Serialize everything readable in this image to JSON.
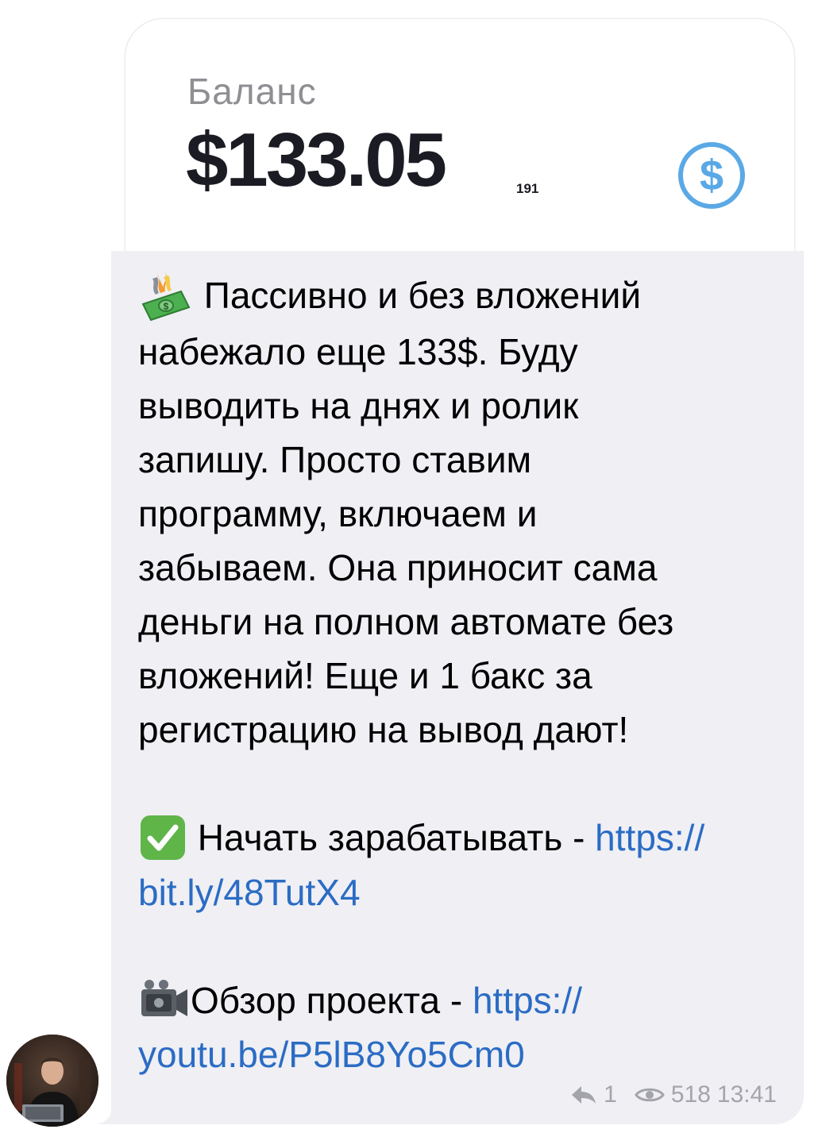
{
  "balance": {
    "label": "Баланс",
    "amount": "$133.05",
    "decimals": "191",
    "icon": "dollar-circle-icon",
    "accent_color": "#5aa9e6"
  },
  "message": {
    "paragraph1": [
      "Пассивно и без вложений",
      "набежало еще 133$. Буду",
      "выводить на днях и ролик",
      "запишу. Просто ставим",
      "программу, включаем и",
      "забываем. Она приносит сама",
      "деньги на полном автомате без",
      "вложений! Еще и 1 бакс за",
      "регистрацию на вывод дают!"
    ],
    "cta": {
      "label": "Начать зарабатывать - ",
      "link_part1": "https://",
      "link_part2": "bit.ly/48TutX4",
      "icon": "check-mark-icon"
    },
    "review": {
      "label": "Обзор проекта - ",
      "link_part1": "https://",
      "link_part2": "youtu.be/P5lB8Yo5Cm0",
      "icon": "video-camera-icon"
    },
    "lead_icon": "money-with-wings-icon",
    "link_color": "#2b6cc4"
  },
  "meta": {
    "replies": "1",
    "views": "518",
    "time": "13:41"
  }
}
